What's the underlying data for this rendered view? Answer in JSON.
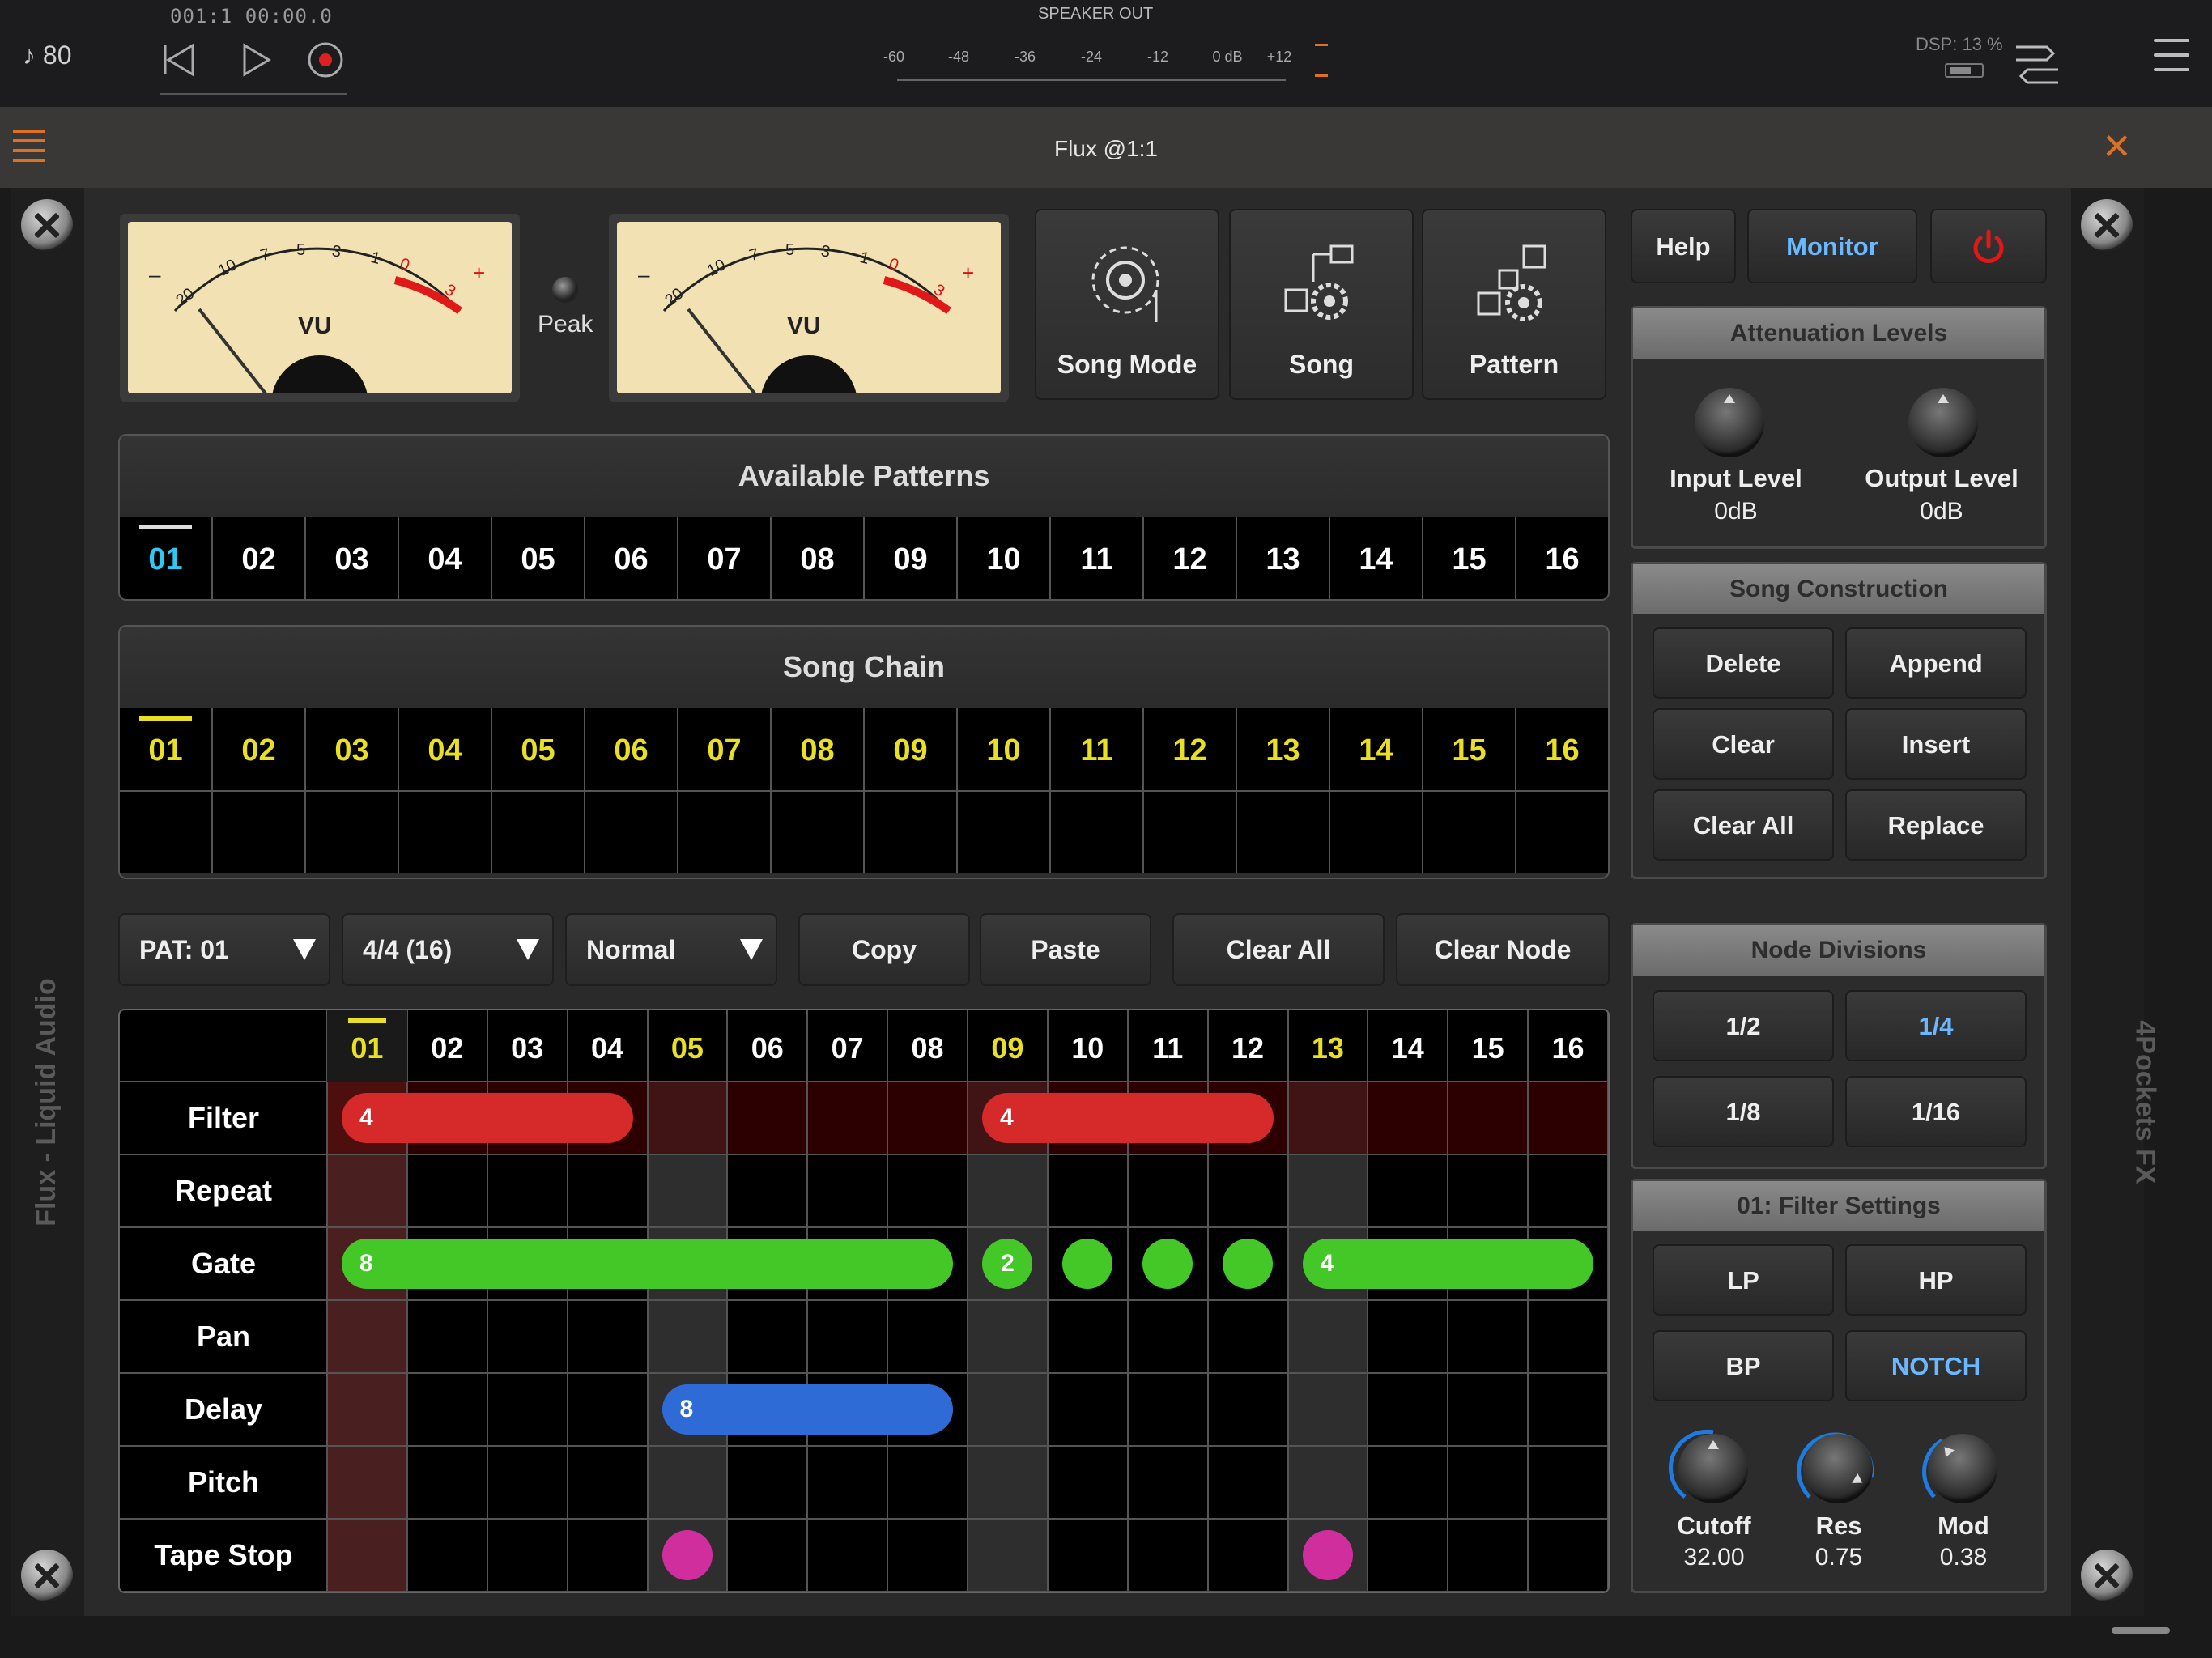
{
  "topbar": {
    "tempo": "♪ 80",
    "position": "001:1   00:00.0",
    "meter_title": "SPEAKER OUT",
    "meter_scale": [
      "-60",
      "-48",
      "-36",
      "-24",
      "-12",
      "0 dB",
      "+12"
    ],
    "dsp": "DSP: 13 %"
  },
  "window": {
    "title": "Flux @1:1"
  },
  "side": {
    "left": "Flux - Liquid Audio",
    "right": "4Pockets FX"
  },
  "vu": {
    "label": "VU",
    "peak": "Peak",
    "scale": [
      "20",
      "10",
      "7",
      "5",
      "3",
      "1",
      "0",
      "3"
    ],
    "minus": "–",
    "plus": "+"
  },
  "modes": [
    {
      "label": "Song Mode"
    },
    {
      "label": "Song"
    },
    {
      "label": "Pattern"
    }
  ],
  "top_buttons": {
    "help": "Help",
    "monitor": "Monitor"
  },
  "available_patterns": {
    "title": "Available Patterns",
    "items": [
      "01",
      "02",
      "03",
      "04",
      "05",
      "06",
      "07",
      "08",
      "09",
      "10",
      "11",
      "12",
      "13",
      "14",
      "15",
      "16"
    ],
    "selected": 0
  },
  "song_chain": {
    "title": "Song Chain",
    "items": [
      "01",
      "02",
      "03",
      "04",
      "05",
      "06",
      "07",
      "08",
      "09",
      "10",
      "11",
      "12",
      "13",
      "14",
      "15",
      "16"
    ],
    "selected": 0
  },
  "controls": {
    "pattern": "PAT: 01",
    "timesig": "4/4 (16)",
    "mode": "Normal",
    "copy": "Copy",
    "paste": "Paste",
    "clear_all": "Clear All",
    "clear_node": "Clear Node"
  },
  "grid": {
    "columns": [
      "01",
      "02",
      "03",
      "04",
      "05",
      "06",
      "07",
      "08",
      "09",
      "10",
      "11",
      "12",
      "13",
      "14",
      "15",
      "16"
    ],
    "rows": [
      "Filter",
      "Repeat",
      "Gate",
      "Pan",
      "Delay",
      "Pitch",
      "Tape Stop"
    ],
    "nodes": [
      {
        "row": 0,
        "start": 1,
        "len": 4,
        "label": "4",
        "color": "#d62a2a",
        "shape": "bar"
      },
      {
        "row": 0,
        "start": 9,
        "len": 4,
        "label": "4",
        "color": "#d62a2a",
        "shape": "bar"
      },
      {
        "row": 2,
        "start": 1,
        "len": 8,
        "label": "8",
        "color": "#44c827",
        "shape": "bar"
      },
      {
        "row": 2,
        "start": 9,
        "len": 1,
        "label": "2",
        "color": "#44c827",
        "shape": "dot"
      },
      {
        "row": 2,
        "start": 10,
        "len": 1,
        "label": "",
        "color": "#44c827",
        "shape": "dot"
      },
      {
        "row": 2,
        "start": 11,
        "len": 1,
        "label": "",
        "color": "#44c827",
        "shape": "dot"
      },
      {
        "row": 2,
        "start": 12,
        "len": 1,
        "label": "",
        "color": "#44c827",
        "shape": "dot"
      },
      {
        "row": 2,
        "start": 13,
        "len": 4,
        "label": "4",
        "color": "#44c827",
        "shape": "bar"
      },
      {
        "row": 4,
        "start": 5,
        "len": 4,
        "label": "8",
        "color": "#2f6bd6",
        "shape": "bar"
      },
      {
        "row": 6,
        "start": 5,
        "len": 1,
        "label": "",
        "color": "#cf2e9c",
        "shape": "dot"
      },
      {
        "row": 6,
        "start": 13,
        "len": 1,
        "label": "",
        "color": "#cf2e9c",
        "shape": "dot"
      }
    ]
  },
  "attenuation": {
    "title": "Attenuation Levels",
    "input_label": "Input Level",
    "input_value": "0dB",
    "output_label": "Output Level",
    "output_value": "0dB"
  },
  "song_construction": {
    "title": "Song Construction",
    "buttons": [
      "Delete",
      "Append",
      "Clear",
      "Insert",
      "Clear All",
      "Replace"
    ]
  },
  "node_divisions": {
    "title": "Node Divisions",
    "buttons": [
      "1/2",
      "1/4",
      "1/8",
      "1/16"
    ],
    "selected": 1
  },
  "filter_settings": {
    "title": "01: Filter Settings",
    "types": [
      "LP",
      "HP",
      "BP",
      "NOTCH"
    ],
    "selected": 3,
    "knobs": [
      {
        "label": "Cutoff",
        "value": "32.00"
      },
      {
        "label": "Res",
        "value": "0.75"
      },
      {
        "label": "Mod",
        "value": "0.38"
      }
    ]
  },
  "colors": {
    "accent": "#e07020",
    "cyan": "#2ec8f0",
    "yellow": "#e8e020",
    "blue": "#6ab8ff",
    "power": "#e01818"
  }
}
